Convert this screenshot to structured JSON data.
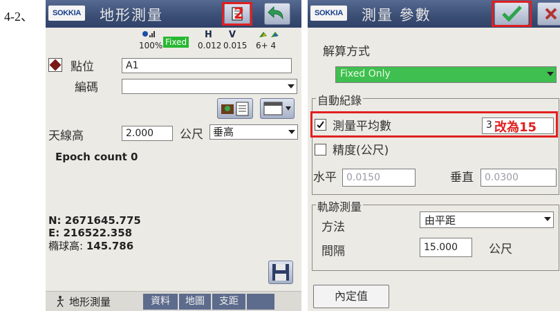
{
  "step_label": "4-2、",
  "left": {
    "logo": "SOKKIA",
    "title": "地形測量",
    "annotation_number": "2",
    "status": {
      "signal_pct": "100%",
      "solution": "Fixed",
      "h_label": "H",
      "h_value": "0.012",
      "v_label": "V",
      "v_value": "0.015",
      "sats": "6+ 4"
    },
    "point_label": "點位",
    "point_value": "A1",
    "code_label": "編碼",
    "code_value": "",
    "antenna_label": "天線高",
    "antenna_value": "2.000",
    "antenna_unit": "公尺",
    "antenna_mode": "垂高",
    "epoch": "Epoch count 0",
    "coords": {
      "n": "N: 2671645.775",
      "e": "E: 216522.358",
      "h_label": "橢球高:",
      "h_value": "145.786"
    },
    "tabs": [
      "地形測量",
      "資料",
      "地圖",
      "支距"
    ]
  },
  "right": {
    "logo": "SOKKIA",
    "title": "測量 參數",
    "solution_label": "解算方式",
    "solution_value": "Fixed Only",
    "auto_record": "自動紀錄",
    "avg_label": "測量平均數",
    "avg_value": "3",
    "annotation_text": "改為15",
    "avg_checked": true,
    "precision_label": "精度(公尺)",
    "precision_checked": false,
    "horiz_label": "水平",
    "horiz_value": "0.0150",
    "vert_label": "垂直",
    "vert_value": "0.0300",
    "track_label": "軌跡測量",
    "method_label": "方法",
    "method_value": "由平距",
    "interval_label": "間隔",
    "interval_value": "15.000",
    "interval_unit": "公尺",
    "default_button": "內定值"
  }
}
